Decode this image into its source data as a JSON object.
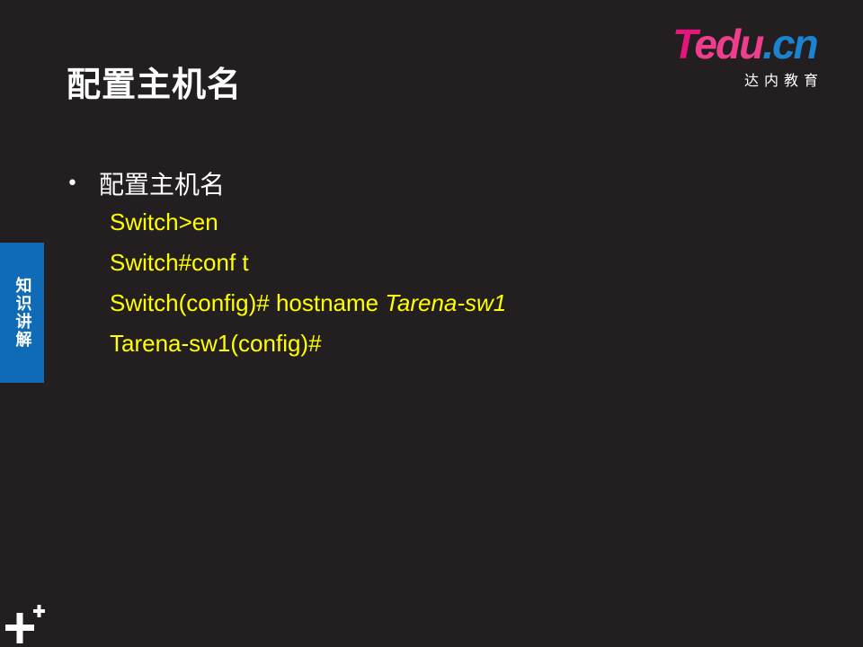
{
  "slide": {
    "title": "配置主机名",
    "bullet": "配置主机名",
    "commands": [
      {
        "text": "Switch>en",
        "italic_part": ""
      },
      {
        "text": "Switch#conf t",
        "italic_part": ""
      },
      {
        "text": "Switch(config)# hostname ",
        "italic_part": "Tarena-sw1"
      },
      {
        "text": "Tarena-sw1(config)#",
        "italic_part": ""
      }
    ]
  },
  "logo": {
    "word_t": "T",
    "word_edu": "edu",
    "word_cn": ".cn",
    "subtitle": "达内教育"
  },
  "side_tab": {
    "label": "知识讲解"
  },
  "icons": {
    "plus": "plus-icon"
  },
  "colors": {
    "background": "#231f20",
    "command_text": "#ffff00",
    "side_tab": "#0f6bb5",
    "logo_pink": "#e6157d",
    "logo_blue": "#1b83cf"
  }
}
